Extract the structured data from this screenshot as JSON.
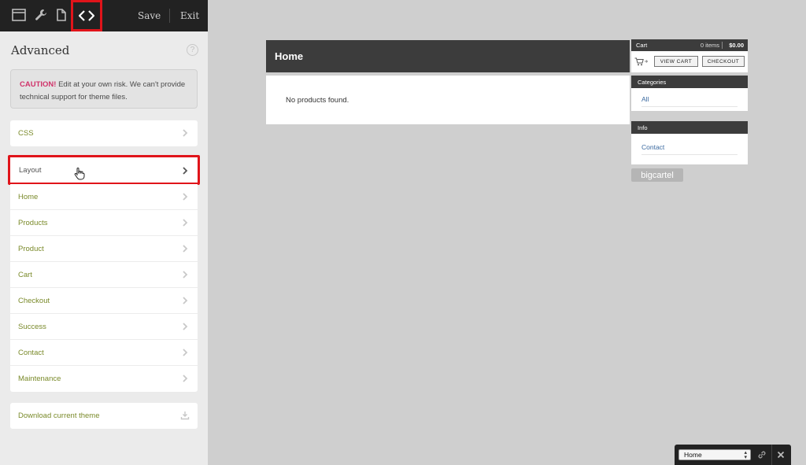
{
  "toolbar": {
    "save_label": "Save",
    "exit_label": "Exit",
    "icons": [
      "window-icon",
      "wrench-icon",
      "file-icon",
      "code-icon"
    ]
  },
  "sidebar": {
    "title": "Advanced",
    "help_label": "?",
    "caution": {
      "word": "CAUTION!",
      "text": " Edit at your own risk. We can't provide technical support for theme files."
    },
    "css_label": "CSS",
    "layout_label": "Layout",
    "pages": [
      "Home",
      "Products",
      "Product",
      "Cart",
      "Checkout",
      "Success",
      "Contact",
      "Maintenance"
    ],
    "download_label": "Download current theme"
  },
  "preview": {
    "page_title": "Home",
    "empty_message": "No products found.",
    "cart": {
      "title": "Cart",
      "count": "0 items",
      "total": "$0.00",
      "view_cart_label": "VIEW CART",
      "checkout_label": "CHECKOUT"
    },
    "categories": {
      "title": "Categories",
      "link": "All"
    },
    "info": {
      "title": "Info",
      "link": "Contact"
    },
    "badge": "bigcartel"
  },
  "page_picker": {
    "selected": "Home"
  },
  "colors": {
    "highlight": "#e0141a",
    "link_green": "#7a8a2a",
    "caution_pink": "#d0336a",
    "dark_header": "#3c3c3c"
  }
}
